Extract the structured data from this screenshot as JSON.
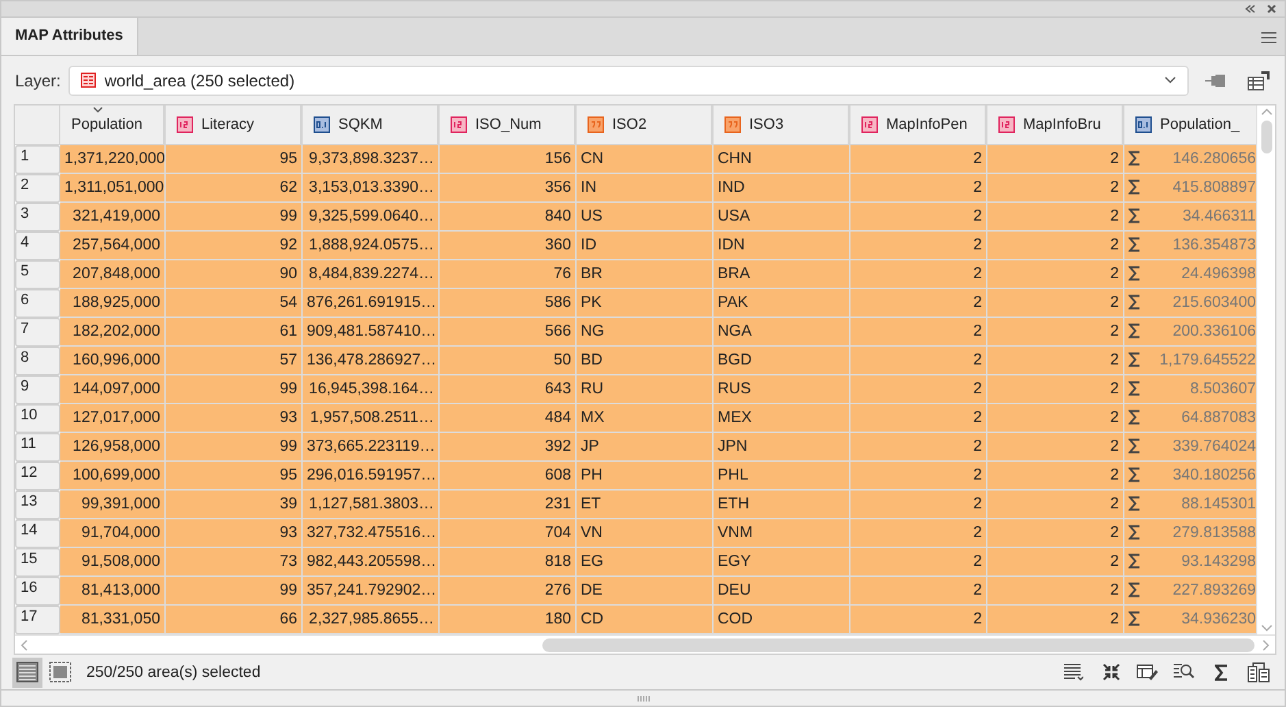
{
  "panel": {
    "tab": {
      "label": "MAP Attributes",
      "selected": true
    }
  },
  "layer": {
    "label": "Layer:",
    "value": "world_area (250 selected)"
  },
  "table": {
    "columns": [
      {
        "label": "Population",
        "kind": "sorted"
      },
      {
        "label": "Literacy",
        "kind": "integer"
      },
      {
        "label": "SQKM",
        "kind": "float"
      },
      {
        "label": "ISO_Num",
        "kind": "integer"
      },
      {
        "label": "ISO2",
        "kind": "text"
      },
      {
        "label": "ISO3",
        "kind": "text"
      },
      {
        "label": "MapInfoPen",
        "kind": "integer"
      },
      {
        "label": "MapInfoBru",
        "kind": "integer"
      },
      {
        "label": "Population_",
        "kind": "sum"
      }
    ],
    "rows": [
      {
        "number": "1",
        "selected": true,
        "cells": [
          "1,371,220,000",
          "95",
          "9,373,898.3237…",
          "156",
          "CN",
          "CHN",
          "2",
          "2",
          "146.280656"
        ]
      },
      {
        "number": "2",
        "selected": true,
        "cells": [
          "1,311,051,000",
          "62",
          "3,153,013.3390…",
          "356",
          "IN",
          "IND",
          "2",
          "2",
          "415.808897"
        ]
      },
      {
        "number": "3",
        "selected": true,
        "cells": [
          "321,419,000",
          "99",
          "9,325,599.0640…",
          "840",
          "US",
          "USA",
          "2",
          "2",
          "34.466311"
        ]
      },
      {
        "number": "4",
        "selected": true,
        "cells": [
          "257,564,000",
          "92",
          "1,888,924.0575…",
          "360",
          "ID",
          "IDN",
          "2",
          "2",
          "136.354873"
        ]
      },
      {
        "number": "5",
        "selected": true,
        "cells": [
          "207,848,000",
          "90",
          "8,484,839.2274…",
          "76",
          "BR",
          "BRA",
          "2",
          "2",
          "24.496398"
        ]
      },
      {
        "number": "6",
        "selected": true,
        "cells": [
          "188,925,000",
          "54",
          "876,261.691915…",
          "586",
          "PK",
          "PAK",
          "2",
          "2",
          "215.603400"
        ]
      },
      {
        "number": "7",
        "selected": true,
        "cells": [
          "182,202,000",
          "61",
          "909,481.587410…",
          "566",
          "NG",
          "NGA",
          "2",
          "2",
          "200.336106"
        ]
      },
      {
        "number": "8",
        "selected": true,
        "cells": [
          "160,996,000",
          "57",
          "136,478.286927…",
          "50",
          "BD",
          "BGD",
          "2",
          "2",
          "1,179.645522"
        ]
      },
      {
        "number": "9",
        "selected": true,
        "cells": [
          "144,097,000",
          "99",
          "16,945,398.164…",
          "643",
          "RU",
          "RUS",
          "2",
          "2",
          "8.503607"
        ]
      },
      {
        "number": "10",
        "selected": true,
        "cells": [
          "127,017,000",
          "93",
          "1,957,508.2511…",
          "484",
          "MX",
          "MEX",
          "2",
          "2",
          "64.887083"
        ]
      },
      {
        "number": "11",
        "selected": true,
        "cells": [
          "126,958,000",
          "99",
          "373,665.223119…",
          "392",
          "JP",
          "JPN",
          "2",
          "2",
          "339.764024"
        ]
      },
      {
        "number": "12",
        "selected": true,
        "cells": [
          "100,699,000",
          "95",
          "296,016.591957…",
          "608",
          "PH",
          "PHL",
          "2",
          "2",
          "340.180256"
        ]
      },
      {
        "number": "13",
        "selected": true,
        "cells": [
          "99,391,000",
          "39",
          "1,127,581.3803…",
          "231",
          "ET",
          "ETH",
          "2",
          "2",
          "88.145301"
        ]
      },
      {
        "number": "14",
        "selected": true,
        "cells": [
          "91,704,000",
          "93",
          "327,732.475516…",
          "704",
          "VN",
          "VNM",
          "2",
          "2",
          "279.813588"
        ]
      },
      {
        "number": "15",
        "selected": true,
        "cells": [
          "91,508,000",
          "73",
          "982,443.205598…",
          "818",
          "EG",
          "EGY",
          "2",
          "2",
          "93.143298"
        ]
      },
      {
        "number": "16",
        "selected": true,
        "cells": [
          "81,413,000",
          "99",
          "357,241.792902…",
          "276",
          "DE",
          "DEU",
          "2",
          "2",
          "227.893269"
        ]
      },
      {
        "number": "17",
        "selected": true,
        "cells": [
          "81,331,050",
          "66",
          "2,327,985.8655…",
          "180",
          "CD",
          "COD",
          "2",
          "2",
          "34.936230"
        ]
      }
    ]
  },
  "status_bar": {
    "views": [
      {
        "kind": "list",
        "selected": true
      },
      {
        "kind": "form",
        "selected": false
      }
    ],
    "text": "250/250 area(s) selected"
  }
}
